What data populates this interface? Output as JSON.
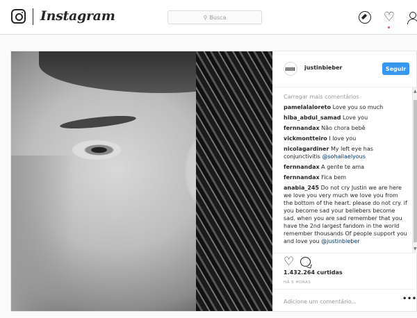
{
  "app": {
    "name": "Instagram"
  },
  "search": {
    "placeholder": "Busca",
    "icon": "search-icon"
  },
  "nav": {
    "icons": [
      "compass-icon",
      "heart-icon",
      "person-icon"
    ],
    "notification_color": "#ed4956"
  },
  "post": {
    "username": "justinbieber",
    "follow_label": "Seguir",
    "accent_color": "#3897f0",
    "load_more": "Carregar mais comentários",
    "comments": [
      {
        "user": "pamelalaloreto",
        "text": "Love you so much"
      },
      {
        "user": "hiba_abdul_samad",
        "text": "Love you"
      },
      {
        "user": "fernnandax",
        "text": "Não chora bebê"
      },
      {
        "user": "vickmontteiro",
        "text": "I love you"
      },
      {
        "user": "nicolagardiner",
        "text": "My left eye has conjunctivitis",
        "mention": "@sohailaelyous"
      },
      {
        "user": "fernnandax",
        "text": "A gente te ama"
      },
      {
        "user": "fernnandax",
        "text": "Fica bem"
      },
      {
        "user": "anabia_245",
        "text": "Do not cry Justin we are here we love you very much we love you from the bottom of the heart. please do not cry. if you become sad your beliebers become sad. when you are sad remember that you have the 2nd largest fandom in the world remember thousands Of people support you and love you",
        "mention": "@justinbieber"
      }
    ],
    "likes": "1.432.264 curtidas",
    "time": "HÁ 5 HORAS",
    "add_comment_placeholder": "Adicione um comentário...",
    "more_label": "•••"
  }
}
